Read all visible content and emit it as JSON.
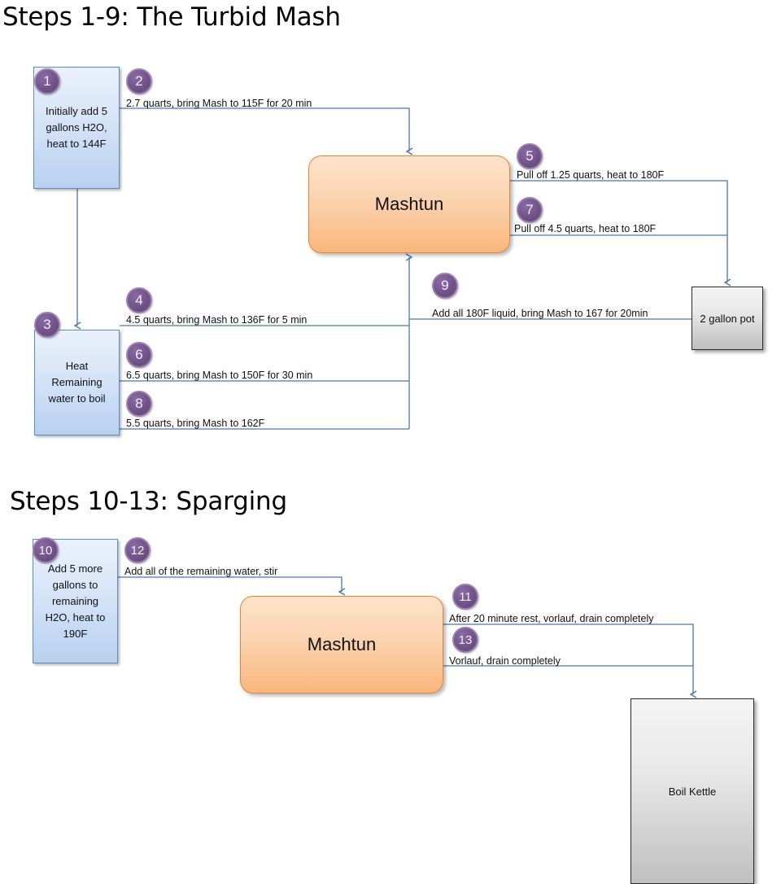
{
  "sections": [
    {
      "title": "Steps 1-9: The Turbid Mash"
    },
    {
      "title": "Steps 10-13: Sparging"
    }
  ],
  "nodes": {
    "step1_box": "Initially add 5 gallons H2O, heat to 144F",
    "step3_box": "Heat Remaining water to boil",
    "mashtun_top": "Mashtun",
    "pot": "2 gallon pot",
    "step10_box": "Add 5 more gallons to remaining H2O, heat to 190F",
    "mashtun_bottom": "Mashtun",
    "boil_kettle": "Boil Kettle"
  },
  "steps": [
    {
      "num": "1",
      "label": ""
    },
    {
      "num": "2",
      "label": "2.7 quarts, bring Mash to 115F for 20 min"
    },
    {
      "num": "3",
      "label": ""
    },
    {
      "num": "4",
      "label": "4.5 quarts, bring Mash to 136F for 5 min"
    },
    {
      "num": "5",
      "label": "Pull off 1.25 quarts, heat to 180F"
    },
    {
      "num": "6",
      "label": "6.5 quarts, bring Mash to 150F for 30 min"
    },
    {
      "num": "7",
      "label": "Pull off 4.5 quarts, heat to 180F"
    },
    {
      "num": "8",
      "label": "5.5 quarts, bring Mash to 162F"
    },
    {
      "num": "9",
      "label": "Add all 180F liquid, bring Mash to 167 for 20min"
    },
    {
      "num": "10",
      "label": ""
    },
    {
      "num": "11",
      "label": "After 20 minute rest, vorlauf, drain completely"
    },
    {
      "num": "12",
      "label": "Add all of the remaining water, stir"
    },
    {
      "num": "13",
      "label": "Vorlauf, drain completely"
    }
  ],
  "colors": {
    "badge_purple": "#6b4f85",
    "box_blue": "#b8d0f0",
    "box_blue_border": "#5b8ec4",
    "box_orange": "#f9b67c",
    "box_orange_border": "#e8852c",
    "box_gray": "#bfbfbf",
    "connector_line": "#4a77ad",
    "title_text": "#000000"
  }
}
